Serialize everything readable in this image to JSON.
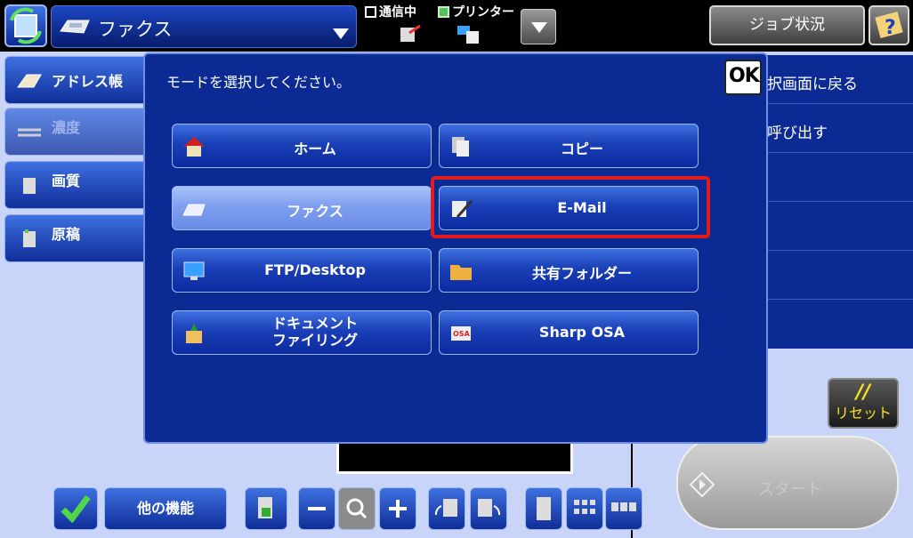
{
  "header": {
    "mode_title": "ファクス",
    "status_communicating": "通信中",
    "status_printer": "プリンター",
    "job_status_label": "ジョブ状況"
  },
  "sidebar": {
    "items": [
      {
        "label": "アドレス帳"
      },
      {
        "label": "濃度"
      },
      {
        "label": "画質"
      },
      {
        "label": "原稿"
      }
    ]
  },
  "right_panel": {
    "items": [
      {
        "label": "択画面に戻る"
      },
      {
        "label": "呼び出す"
      }
    ]
  },
  "modal": {
    "prompt": "モードを選択してください。",
    "ok_label": "OK",
    "modes": [
      {
        "label": "ホーム",
        "icon": "home-icon"
      },
      {
        "label": "コピー",
        "icon": "copy-icon"
      },
      {
        "label": "ファクス",
        "icon": "fax-icon",
        "selected": true
      },
      {
        "label": "E-Mail",
        "icon": "email-icon",
        "highlighted": true
      },
      {
        "label": "FTP/Desktop",
        "icon": "desktop-icon"
      },
      {
        "label": "共有フォルダー",
        "icon": "folder-icon"
      },
      {
        "label_line1": "ドキュメント",
        "label_line2": "ファイリング",
        "icon": "document-filing-icon"
      },
      {
        "label": "Sharp OSA",
        "icon": "osa-icon"
      }
    ]
  },
  "footer": {
    "other_functions": "他の機能",
    "reset_label": "リセット",
    "start_label": "スタート"
  },
  "colors": {
    "panel_blue": "#0b2a93",
    "button_blue": "#1a3fb6",
    "highlight_red": "#e31b1b",
    "reset_text": "#f8e320"
  }
}
